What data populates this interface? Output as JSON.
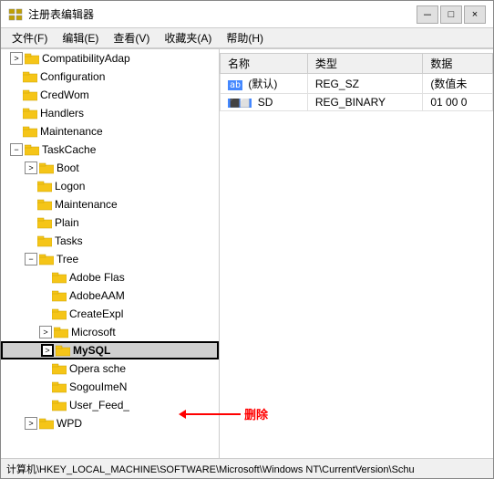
{
  "window": {
    "title": "注册表编辑器",
    "controls": {
      "minimize": "－",
      "maximize": "□",
      "close": "×"
    }
  },
  "menu": {
    "items": [
      "文件(F)",
      "编辑(E)",
      "查看(V)",
      "收藏夹(A)",
      "帮助(H)"
    ]
  },
  "tree": {
    "items": [
      {
        "id": "compat",
        "label": "CompatibilityAdap",
        "indent": 1,
        "expanded": false,
        "hasChildren": true
      },
      {
        "id": "config",
        "label": "Configuration",
        "indent": 1,
        "expanded": false,
        "hasChildren": false
      },
      {
        "id": "credwom",
        "label": "CredWom",
        "indent": 1,
        "expanded": false,
        "hasChildren": false
      },
      {
        "id": "handlers",
        "label": "Handlers",
        "indent": 1,
        "expanded": false,
        "hasChildren": false
      },
      {
        "id": "maintenance",
        "label": "Maintenance",
        "indent": 1,
        "expanded": false,
        "hasChildren": false
      },
      {
        "id": "taskcache",
        "label": "TaskCache",
        "indent": 1,
        "expanded": true,
        "hasChildren": true
      },
      {
        "id": "boot",
        "label": "Boot",
        "indent": 2,
        "expanded": false,
        "hasChildren": true
      },
      {
        "id": "logon",
        "label": "Logon",
        "indent": 2,
        "expanded": false,
        "hasChildren": false
      },
      {
        "id": "maintenance2",
        "label": "Maintenance",
        "indent": 2,
        "expanded": false,
        "hasChildren": false
      },
      {
        "id": "plain",
        "label": "Plain",
        "indent": 2,
        "expanded": false,
        "hasChildren": false
      },
      {
        "id": "tasks",
        "label": "Tasks",
        "indent": 2,
        "expanded": false,
        "hasChildren": false
      },
      {
        "id": "tree",
        "label": "Tree",
        "indent": 2,
        "expanded": true,
        "hasChildren": true
      },
      {
        "id": "adobe_flas",
        "label": "Adobe Flas",
        "indent": 3,
        "expanded": false,
        "hasChildren": false
      },
      {
        "id": "adobeaam",
        "label": "AdobeAAM",
        "indent": 3,
        "expanded": false,
        "hasChildren": false
      },
      {
        "id": "createexpl",
        "label": "CreateExpl",
        "indent": 3,
        "expanded": false,
        "hasChildren": false
      },
      {
        "id": "microsoft",
        "label": "Microsoft",
        "indent": 3,
        "expanded": false,
        "hasChildren": true
      },
      {
        "id": "mysql",
        "label": "MySQL",
        "indent": 3,
        "expanded": false,
        "hasChildren": false,
        "selected": true,
        "highlighted": true
      },
      {
        "id": "opera",
        "label": "Opera sche",
        "indent": 3,
        "expanded": false,
        "hasChildren": false
      },
      {
        "id": "sogoulme",
        "label": "SogouImeN",
        "indent": 3,
        "expanded": false,
        "hasChildren": false
      },
      {
        "id": "user_feed",
        "label": "User_Feed_",
        "indent": 3,
        "expanded": false,
        "hasChildren": false
      },
      {
        "id": "wpd",
        "label": "WPD",
        "indent": 2,
        "expanded": false,
        "hasChildren": true
      }
    ]
  },
  "right_panel": {
    "columns": [
      "名称",
      "类型",
      "数据"
    ],
    "rows": [
      {
        "name": "(默认)",
        "type": "REG_SZ",
        "data": "(数值未",
        "icon": "ab"
      },
      {
        "name": "SD",
        "type": "REG_BINARY",
        "data": "01 00 0",
        "icon": "bin"
      }
    ]
  },
  "status_bar": {
    "text": "计算机\\HKEY_LOCAL_MACHINE\\SOFTWARE\\Microsoft\\Windows NT\\CurrentVersion\\Schu"
  },
  "annotation": {
    "delete_text": "删除"
  }
}
